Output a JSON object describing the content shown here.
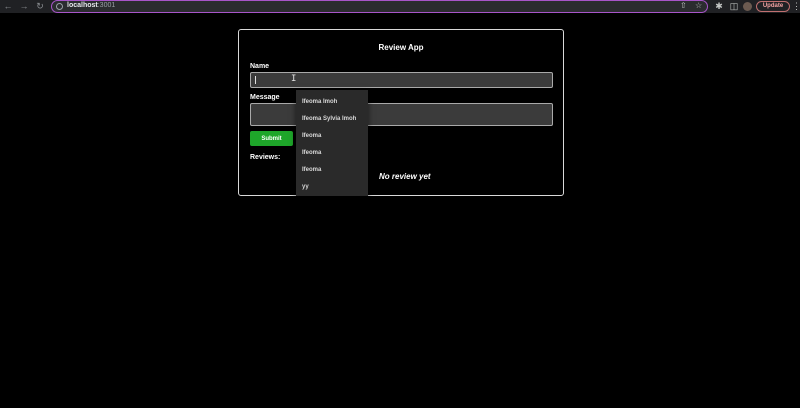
{
  "browser": {
    "url_host": "localhost",
    "url_port": ":3001",
    "update_label": "Update"
  },
  "app": {
    "title": "Review App",
    "name_label": "Name",
    "message_label": "Message",
    "name_value": "",
    "message_value": "",
    "submit_label": "Submit",
    "reviews_label": "Reviews:",
    "empty_text": "No review yet"
  },
  "autocomplete": {
    "items": [
      "Ifeoma Imoh",
      "Ifeoma Sylvia Imoh",
      "Ifeoma",
      "Ifeoma",
      "Ifeoma",
      "yy"
    ]
  }
}
